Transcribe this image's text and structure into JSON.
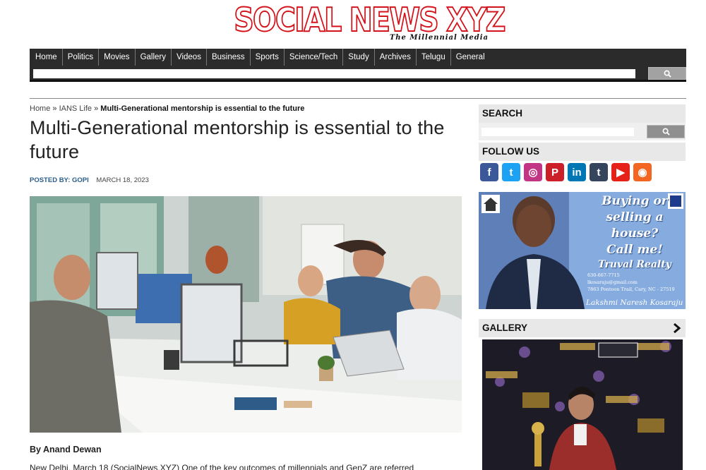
{
  "logo": {
    "text": "SOCIAL NEWS XYZ",
    "tagline": "The Millennial Media"
  },
  "nav": [
    "Home",
    "Politics",
    "Movies",
    "Gallery",
    "Videos",
    "Business",
    "Sports",
    "Science/Tech",
    "Study",
    "Archives",
    "Telugu",
    "General"
  ],
  "breadcrumb": {
    "home": "Home",
    "sep1": " » ",
    "section": "IANS Life",
    "sep2": " » ",
    "current": "Multi-Generational mentorship is essential to the future"
  },
  "article": {
    "title": "Multi-Generational mentorship is essential to the future",
    "posted_by": "POSTED BY: GOPI",
    "date": "MARCH 18, 2023",
    "byline": "By Anand Dewan",
    "body_start": "New Delhi, March 18 (SocialNews.XYZ) One of the key outcomes of millennials and GenZ are referred"
  },
  "sidebar": {
    "search_heading": "SEARCH",
    "follow_heading": "FOLLOW US",
    "gallery_heading": "GALLERY",
    "social_icons": [
      {
        "name": "facebook-icon",
        "glyph": "f",
        "color": "#3b5998"
      },
      {
        "name": "twitter-icon",
        "glyph": "t",
        "color": "#1da1f2"
      },
      {
        "name": "instagram-icon",
        "glyph": "◎",
        "color": "#c13584"
      },
      {
        "name": "pinterest-icon",
        "glyph": "P",
        "color": "#cb2027"
      },
      {
        "name": "linkedin-icon",
        "glyph": "in",
        "color": "#0077b5"
      },
      {
        "name": "tumblr-icon",
        "glyph": "t",
        "color": "#35465c"
      },
      {
        "name": "youtube-icon",
        "glyph": "▶",
        "color": "#e62117"
      },
      {
        "name": "rss-icon",
        "glyph": "◉",
        "color": "#f26522"
      }
    ]
  },
  "ad": {
    "line1": "Buying or",
    "line2": "selling a",
    "line3": "house?",
    "line4": "Call me!",
    "brand": "Truval Realty",
    "phone": "630-667-7715",
    "email": "lkosaraju@gmail.com",
    "address": "7863 Pontoon Trail, Cary, NC - 27519",
    "name": "Lakshmi Naresh Kosaraju"
  },
  "colors": {
    "brand_red": "#d4141c",
    "nav_bg": "#2b2b2b",
    "link_blue": "#2a5d8a"
  }
}
